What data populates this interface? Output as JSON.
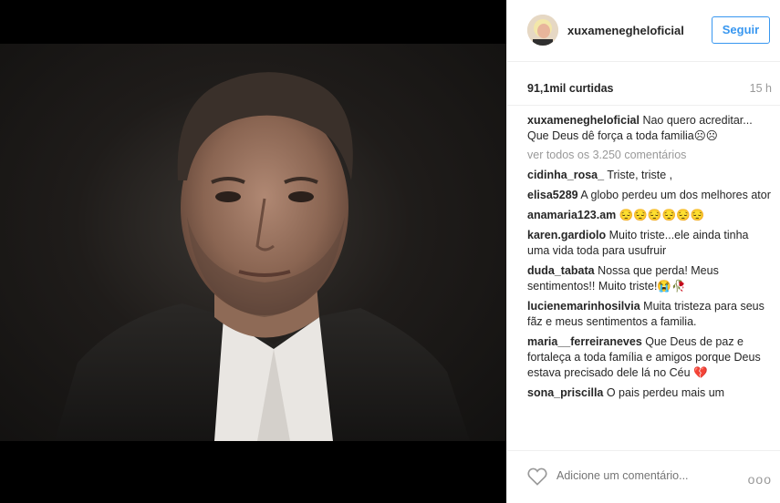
{
  "post": {
    "username": "xuxamenegheloficial",
    "follow_label": "Seguir",
    "likes": "91,1mil curtidas",
    "time": "15 h"
  },
  "caption": {
    "username": "xuxamenegheloficial",
    "line1": "Nao quero acreditar...",
    "line2": "Que Deus dê força a toda familia☹☹"
  },
  "view_all": "ver todos os 3.250 comentários",
  "comments": [
    {
      "user": "cidinha_rosa_",
      "text": "Triste, triste ,"
    },
    {
      "user": "elisa5289",
      "text": "A globo perdeu um dos melhores ator"
    },
    {
      "user": "anamaria123.am",
      "text": "😔😔😔😔😔😔"
    },
    {
      "user": "karen.gardiolo",
      "text": "Muito triste...ele ainda tinha uma vida toda para usufruir"
    },
    {
      "user": "duda_tabata",
      "text": "Nossa que perda! Meus sentimentos!! Muito triste!😭🥀"
    },
    {
      "user": "lucienemarinhosilvia",
      "text": "Muita tristeza para seus fãz e meus sentimentos a familia."
    },
    {
      "user": "maria__ferreiraneves",
      "text": "Que Deus de paz e fortaleça a toda família e amigos porque Deus estava precisado dele lá no Céu 💔"
    },
    {
      "user": "sona_priscilla",
      "text": "O pais perdeu mais um"
    }
  ],
  "footer": {
    "placeholder": "Adicione um comentário...",
    "more": "ooo"
  }
}
